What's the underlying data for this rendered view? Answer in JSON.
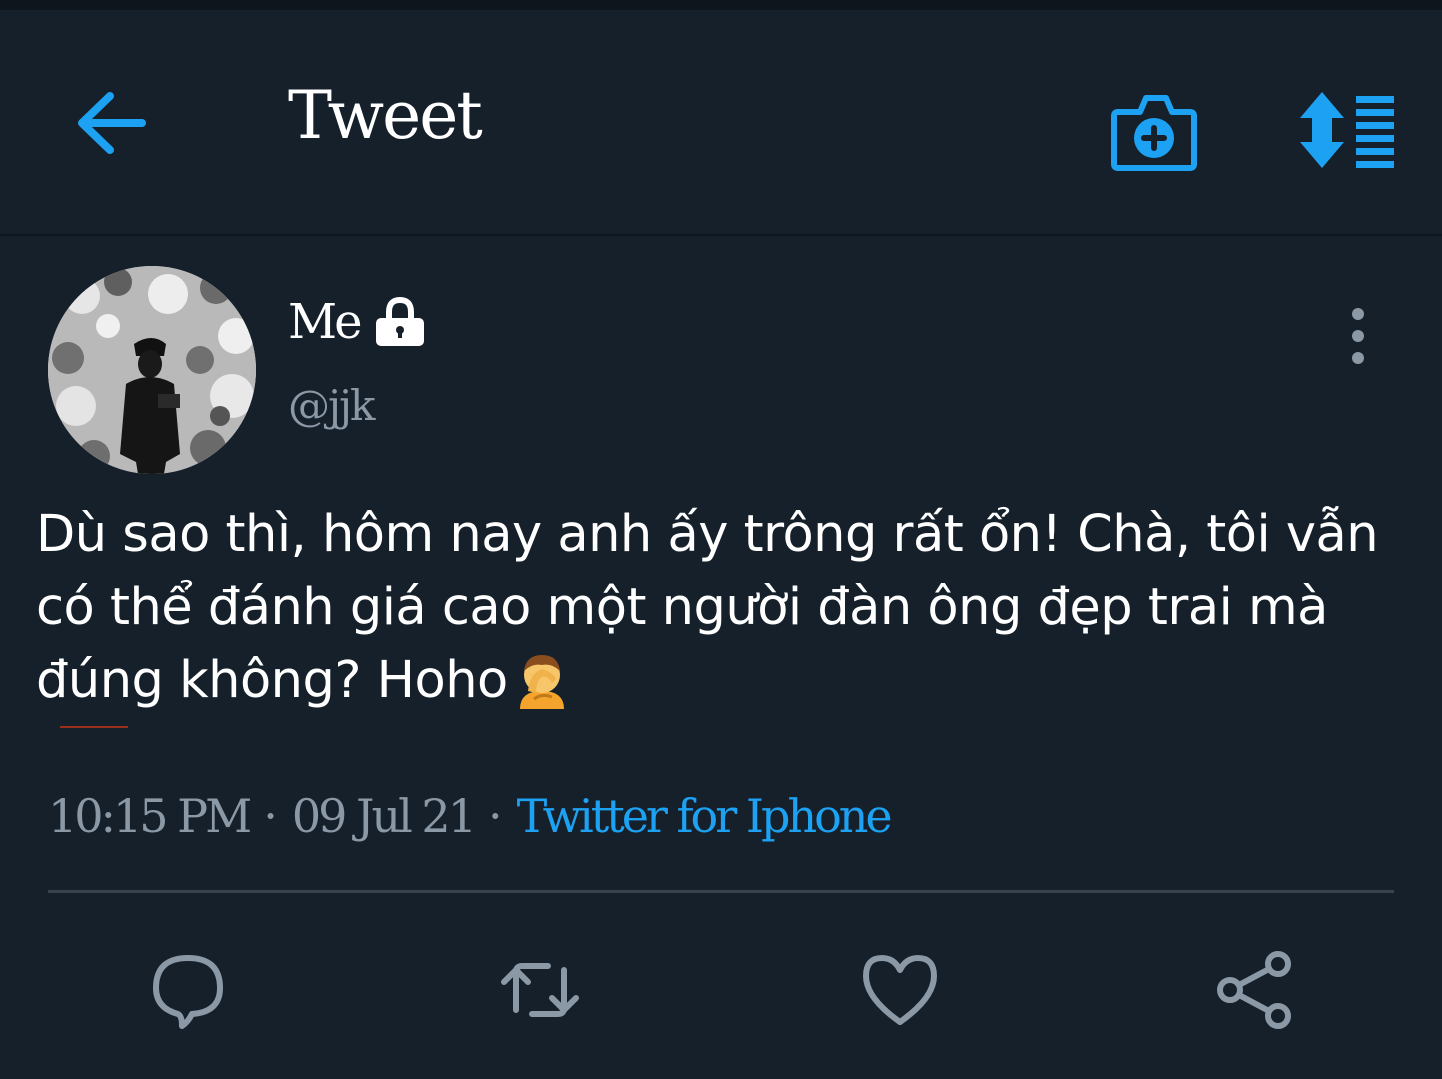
{
  "header": {
    "title": "Tweet",
    "back_icon": "arrow-left-icon",
    "camera_icon": "camera-plus-icon",
    "sort_icon": "sort-list-icon",
    "accent_color": "#1da1f2"
  },
  "tweet": {
    "author_name": "Me",
    "author_handle": "@jjk",
    "protected_icon": "lock-icon",
    "text": "Dù sao thì, hôm nay anh ấy trông rất ổn! Chà, tôi vẫn có thể đánh giá cao một người đàn ông đẹp trai mà đúng không? Hoho",
    "emoji": "facepalm-emoji",
    "time": "10:15 PM",
    "date": "09 Jul 21",
    "separator": "·",
    "source": "Twitter for Iphone"
  },
  "actions": [
    {
      "name": "reply",
      "icon": "comment-icon"
    },
    {
      "name": "retweet",
      "icon": "retweet-icon"
    },
    {
      "name": "like",
      "icon": "heart-icon"
    },
    {
      "name": "share",
      "icon": "share-icon"
    }
  ],
  "colors": {
    "background": "#15202b",
    "text_primary": "#ffffff",
    "text_secondary": "#8b98a5",
    "divider": "#38444d"
  }
}
